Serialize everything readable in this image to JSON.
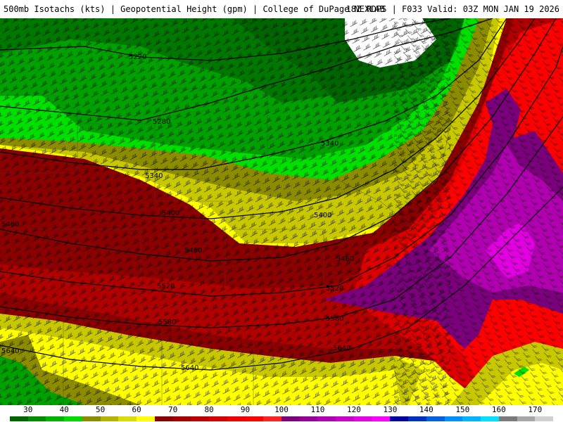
{
  "header": {
    "left": "500mb Isotachs (kts) | Geopotential Height (gpm) | College of DuPage NEXLAB",
    "right": "18Z RDPS | F033 Valid: 03Z MON JAN 19 2026"
  },
  "contours": [
    {
      "label": "5220"
    },
    {
      "label": "5280"
    },
    {
      "label": "5340"
    },
    {
      "label": "5340"
    },
    {
      "label": "5400"
    },
    {
      "label": "5400"
    },
    {
      "label": "5460"
    },
    {
      "label": "5460"
    },
    {
      "label": "5520"
    },
    {
      "label": "5520"
    },
    {
      "label": "5580"
    },
    {
      "label": "5580"
    },
    {
      "label": "5640"
    },
    {
      "label": "5640"
    },
    {
      "label": "5640"
    },
    {
      "label": "5460"
    }
  ],
  "legend": {
    "ticks": [
      "30",
      "40",
      "50",
      "60",
      "70",
      "80",
      "90",
      "100",
      "110",
      "120",
      "130",
      "140",
      "150",
      "160",
      "170"
    ],
    "colors": [
      "#006400",
      "#008c00",
      "#00b400",
      "#00dc00",
      "#8c8c00",
      "#b4b400",
      "#dcdc00",
      "#ffff00",
      "#8b0000",
      "#a50000",
      "#be0000",
      "#d70000",
      "#f00000",
      "#ff0000",
      "#ff2020",
      "#7b007b",
      "#960096",
      "#b000b0",
      "#ca00ca",
      "#e500e5",
      "#ff00ff",
      "#0000a0",
      "#0030c0",
      "#0060e0",
      "#0090ff",
      "#00b4ff",
      "#00e0ff",
      "#7a7a7a",
      "#a8a8a8",
      "#d0d0d0"
    ]
  },
  "colors": {
    "v30": "#006400",
    "v40": "#00a000",
    "v50": "#00e000",
    "v60": "#8c8c00",
    "v65": "#c8c800",
    "v70": "#ffff00",
    "v80": "#8b0000",
    "v85": "#b00000",
    "v90": "#dd0000",
    "v100": "#ff0000",
    "v110": "#7b007b",
    "v120": "#b000b0",
    "v130": "#e000e0"
  }
}
